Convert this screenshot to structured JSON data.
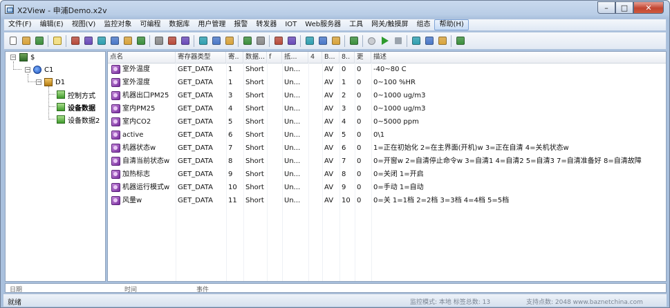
{
  "window": {
    "title": "X2View - 申浦Demo.x2v"
  },
  "window_controls": {
    "minimize": "–",
    "maximize": "□",
    "close": "✕"
  },
  "menu": [
    "文件(F)",
    "编辑(E)",
    "视图(V)",
    "监控对象",
    "可编程",
    "数据库",
    "用户管理",
    "报警",
    "转发器",
    "IOT",
    "Web服务器",
    "工具",
    "网关/触摸屏",
    "组态",
    "帮助(H)"
  ],
  "toolbar": {
    "icons": [
      "new-file-icon",
      "open-folder-icon",
      "save-icon",
      "sep",
      "help-icon",
      "sep",
      "device-icon",
      "device-add-icon",
      "device-list-icon",
      "copy-icon",
      "database-icon",
      "export-icon",
      "sep",
      "cut-icon",
      "copy-doc-icon",
      "paste-icon",
      "sep",
      "align-icon",
      "grid-icon",
      "timer-icon",
      "sep",
      "users-icon",
      "transfer-icon",
      "sep",
      "chart-icon",
      "table-icon",
      "sep",
      "iot-icon",
      "network-icon",
      "web-icon",
      "sep",
      "server-icon",
      "sep",
      "record-icon",
      "play-icon",
      "stop-icon",
      "sep",
      "tools-icon",
      "print-icon",
      "print-preview-icon",
      "sep",
      "monitor-icon"
    ]
  },
  "tree": {
    "root": "$",
    "c1": "C1",
    "d1": "D1",
    "children": [
      "控制方式",
      "设备数据",
      "设备数据2"
    ]
  },
  "grid": {
    "headers": [
      "点名",
      "寄存器类型",
      "寄..",
      "数据...",
      "f",
      "抵...",
      "4",
      "B...",
      "8..",
      "更",
      "描述"
    ],
    "rows": [
      [
        "室外温度",
        "GET_DATA",
        "1",
        "Short",
        "Un...",
        "AV",
        "0",
        "0",
        "-40~80 C"
      ],
      [
        "室外湿度",
        "GET_DATA",
        "1",
        "Short",
        "Un...",
        "AV",
        "1",
        "0",
        "0~100 %HR"
      ],
      [
        "机器出口PM25",
        "GET_DATA",
        "3",
        "Short",
        "Un...",
        "AV",
        "2",
        "0",
        "0~1000 ug/m3"
      ],
      [
        "室内PM25",
        "GET_DATA",
        "4",
        "Short",
        "Un...",
        "AV",
        "3",
        "0",
        "0~1000 ug/m3"
      ],
      [
        "室内CO2",
        "GET_DATA",
        "5",
        "Short",
        "Un...",
        "AV",
        "4",
        "0",
        "0~5000 ppm"
      ],
      [
        "active",
        "GET_DATA",
        "6",
        "Short",
        "Un...",
        "AV",
        "5",
        "0",
        "0\\1"
      ],
      [
        "机器状态w",
        "GET_DATA",
        "7",
        "Short",
        "Un...",
        "AV",
        "6",
        "0",
        "1=正在初始化 2=在主界面(开机)w 3=正在自清 4=关机状态w"
      ],
      [
        "自清当前状态w",
        "GET_DATA",
        "8",
        "Short",
        "Un...",
        "AV",
        "7",
        "0",
        "0=开窗w 2=自清停止命令w 3=自清1 4=自清2 5=自清3 7=自清准备好 8=自清故障"
      ],
      [
        "加热标志",
        "GET_DATA",
        "9",
        "Short",
        "Un...",
        "AV",
        "8",
        "0",
        "0=关闭 1=开启"
      ],
      [
        "机器运行模式w",
        "GET_DATA",
        "10",
        "Short",
        "Un...",
        "AV",
        "9",
        "0",
        "0=手动 1=自动"
      ],
      [
        "风量w",
        "GET_DATA",
        "11",
        "Short",
        "Un...",
        "AV",
        "10",
        "0",
        "0=关 1=1档 2=2档 3=3档 4=4档 5=5档"
      ]
    ]
  },
  "bottom_panel": {
    "col1": "日期",
    "col2": "时间",
    "col3": "事件"
  },
  "status": {
    "left": "就绪",
    "monitor_mode": "监控模式: 本地  标签总数: 13",
    "support": "支持点数: 2048  www.baznetchina.com"
  },
  "colors": {
    "accent": "#7a2fa0",
    "title_bar": "#b9cde6",
    "close_button": "#c24531"
  }
}
